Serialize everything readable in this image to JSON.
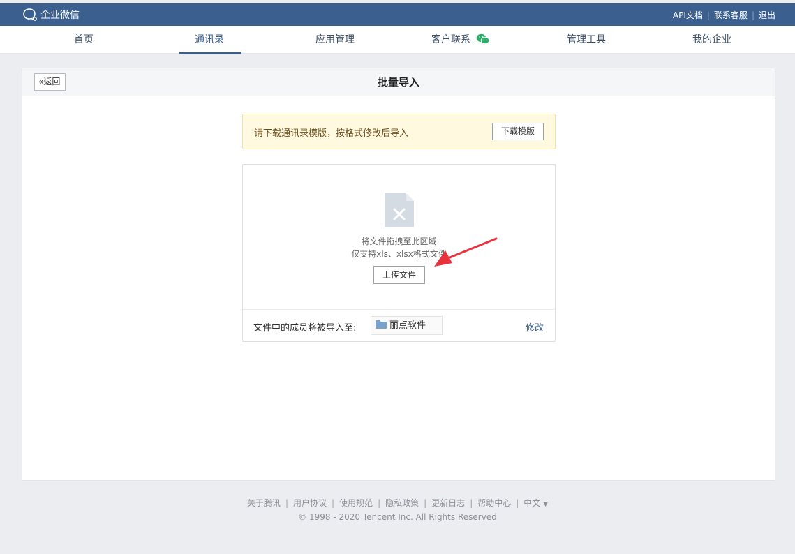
{
  "header": {
    "logo_text": "企业微信",
    "links": [
      "API文档",
      "联系客服",
      "退出"
    ]
  },
  "nav": {
    "items": [
      "首页",
      "通讯录",
      "应用管理",
      "客户联系",
      "管理工具",
      "我的企业"
    ],
    "active": "通讯录"
  },
  "card": {
    "back_label": "返回",
    "title": "批量导入"
  },
  "notice": {
    "text": "请下载通讯录模版，按格式修改后导入",
    "button": "下载模版"
  },
  "upload": {
    "drop_text": "将文件拖拽至此区域",
    "format_text": "仅支持xls、xlsx格式文件",
    "button": "上传文件",
    "target_label": "文件中的成员将被导入至:",
    "target_department": "丽点软件",
    "modify_label": "修改"
  },
  "footer": {
    "links": [
      "关于腾讯",
      "用户协议",
      "使用规范",
      "隐私政策",
      "更新日志",
      "帮助中心"
    ],
    "language": "中文",
    "language_caret": "▼",
    "copyright": "© 1998 - 2020 Tencent Inc. All Rights Reserved"
  },
  "icons": {
    "logo": "wework-logo-icon",
    "wechat": "wechat-icon",
    "file": "excel-file-icon",
    "folder": "folder-icon",
    "back": "double-chevron-left-icon",
    "annotation": "red-arrow-annotation"
  },
  "colors": {
    "header_bg": "#3b5f8f",
    "accent": "#3b5f8f",
    "notice_bg": "#fff9e0",
    "wechat_green": "#2aae67",
    "annotation_red": "#e8333c"
  }
}
